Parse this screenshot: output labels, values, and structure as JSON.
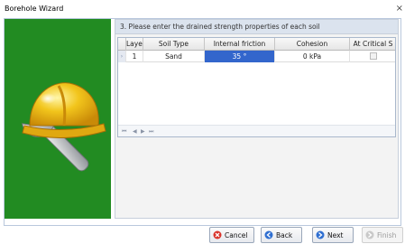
{
  "window": {
    "title": "Borehole Wizard",
    "close_glyph": "×"
  },
  "step": {
    "instruction": "3. Please enter the drained strength properties of each soil"
  },
  "table": {
    "columns": [
      "Layer",
      "Soil Type",
      "Internal friction",
      "Cohesion",
      "At Critical S"
    ],
    "rows": [
      {
        "indicator": "›",
        "layer": "1",
        "soil_type": "Sand",
        "internal_friction": "35 °",
        "cohesion": "0 kPa",
        "at_critical": false
      }
    ],
    "selected_cell": "internal_friction"
  },
  "navigator": {
    "first": "⏮",
    "prev": "◀",
    "next": "▶",
    "last": "⏭"
  },
  "buttons": {
    "cancel": "Cancel",
    "back": "Back",
    "next": "Next",
    "finish": "Finish"
  },
  "icons": {
    "illustration": "hardhat-wrench-icon",
    "cancel": "cancel-icon",
    "back": "back-arrow-icon",
    "next": "next-arrow-icon",
    "finish": "finish-icon"
  },
  "colors": {
    "panel_green": "#228b22",
    "selection_blue": "#3366cc",
    "helmet_yellow": "#f2c51c"
  }
}
